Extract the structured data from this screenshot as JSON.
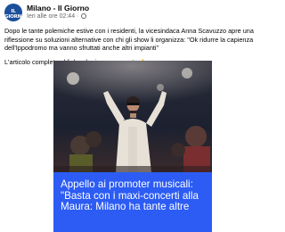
{
  "post": {
    "page_name": "Milano - Il Giorno",
    "avatar_text": "IL GIORNO",
    "timestamp": "Ieri alle ore 02:44",
    "separator": " · ",
    "text_main": "Dopo le tante polemiche estive con i residenti, la vicesindaca Anna Scavuzzo apre una riflessione su soluzioni alternative con chi gli show li organizza: \"Ok ridurre la capienza dell'Ippodromo ma vanno sfruttati anche altri impianti\"",
    "text_link_note": "L'articolo completo al link nel primo commento",
    "emoji": "👉"
  },
  "media": {
    "caption": "Appello ai promoter musicali: \"Basta con i maxi-concerti alla Maura: Milano ha tante altre"
  },
  "colors": {
    "caption_bg": "#2c5cf4",
    "brand_blue": "#1b4f9c"
  }
}
